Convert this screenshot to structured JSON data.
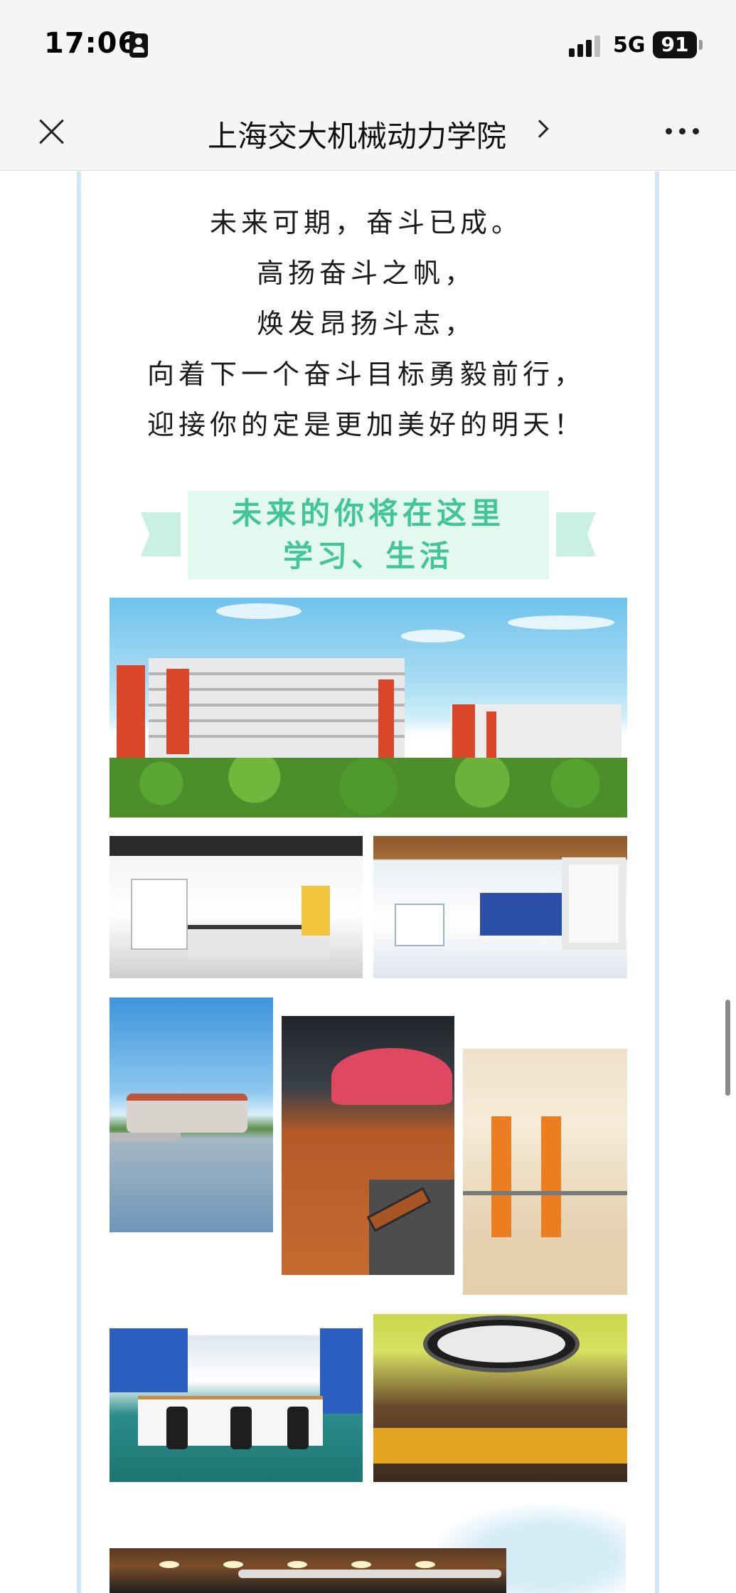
{
  "status_bar": {
    "time": "17:06",
    "network": "5G",
    "battery": "91"
  },
  "nav": {
    "title": "上海交大机械动力学院"
  },
  "poem": {
    "lines": [
      "未来可期，奋斗已成。",
      "高扬奋斗之帆，",
      "焕发昂扬斗志，",
      "向着下一个奋斗目标勇毅前行，",
      "迎接你的定是更加美好的明天！"
    ]
  },
  "banner": {
    "line1": "未来的你将在这里",
    "line2": "学习、生活",
    "accent_color": "#43c49a",
    "background_color": "#e3f9ef"
  },
  "icons": {
    "close": "close-icon",
    "more": "more-icon",
    "chevron": "chevron-right-icon",
    "contact": "contact-card-icon",
    "signal": "signal-icon",
    "battery": "battery-icon"
  }
}
